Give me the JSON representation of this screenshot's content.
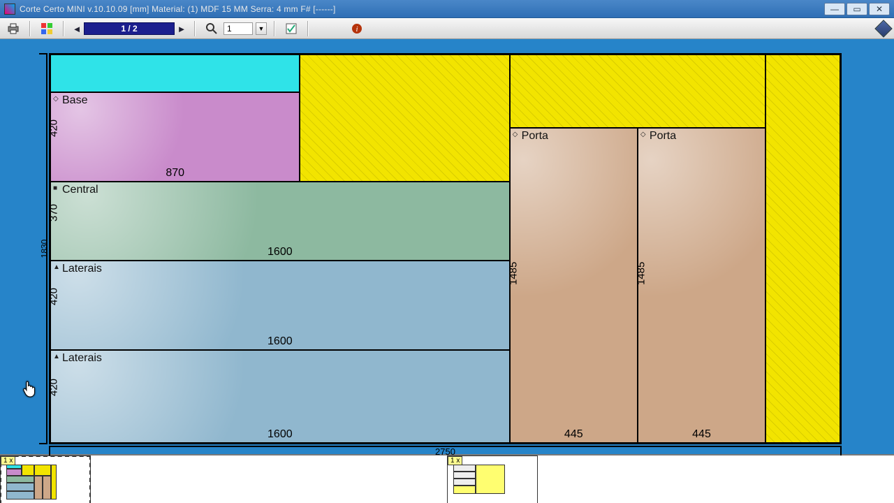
{
  "window": {
    "title": "Corte Certo MINI v.10.10.09   [mm] Material: (1) MDF 15 MM    Serra: 4 mm    F#    [------]"
  },
  "toolbar": {
    "page_indicator": "1 / 2",
    "zoom_value": "1"
  },
  "sheet": {
    "width_label": "2750",
    "height_label": "1830"
  },
  "pieces": {
    "base": {
      "name": "Base",
      "w": "870",
      "h": "420"
    },
    "central": {
      "name": "Central",
      "w": "1600",
      "h": "370"
    },
    "laterais": {
      "name": "Laterais",
      "w": "1600",
      "h": "420"
    },
    "porta": {
      "name": "Porta",
      "w": "445",
      "h": "1485"
    }
  },
  "thumbs": {
    "t1": "1 x",
    "t2": "1 x"
  }
}
